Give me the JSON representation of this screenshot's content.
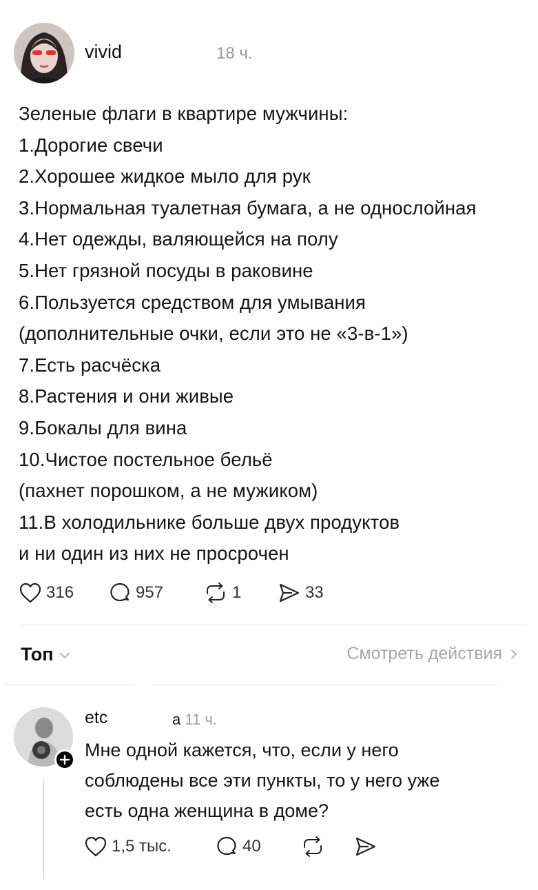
{
  "post": {
    "username": "vivid",
    "time": "18 ч.",
    "lines": [
      "Зеленые флаги в квартире мужчины:",
      "1.Дорогие свечи",
      "2.Хорошее жидкое мыло для рук",
      "3.Нормальная туалетная бумага, а не однослойная",
      "4.Нет одежды, валяющейся на полу",
      "5.Нет грязной посуды в раковине",
      "6.Пользуется средством для умывания",
      "(дополнительные очки, если это не «3-в-1»)",
      "7.Есть расчёска",
      "8.Растения и они живые",
      "9.Бокалы для вина",
      "10.Чистое постельное бельё",
      "(пахнет порошком, а не мужиком)",
      "11.В холодильнике больше двух продуктов",
      "и ни один из них не просрочен"
    ],
    "likes": "316",
    "comments": "957",
    "reposts": "1",
    "shares": "33"
  },
  "replies_header": {
    "sort_label": "Топ",
    "view_actions_label": "Смотреть действия"
  },
  "reply": {
    "username": "etc",
    "time_prefix": "а",
    "time": "11 ч.",
    "lines": [
      "Мне одной кажется, что, если у него",
      "соблюдены все эти пункты, то у него уже",
      "есть одна женщина в доме?"
    ],
    "likes": "1,5 тыс.",
    "comments": "40"
  },
  "icons": {
    "like": "heart-icon",
    "comment": "comment-bubble-icon",
    "repost": "repost-icon",
    "share": "send-icon",
    "follow": "plus-icon",
    "chevron_down": "chevron-down-icon",
    "chevron_right": "chevron-right-icon"
  }
}
